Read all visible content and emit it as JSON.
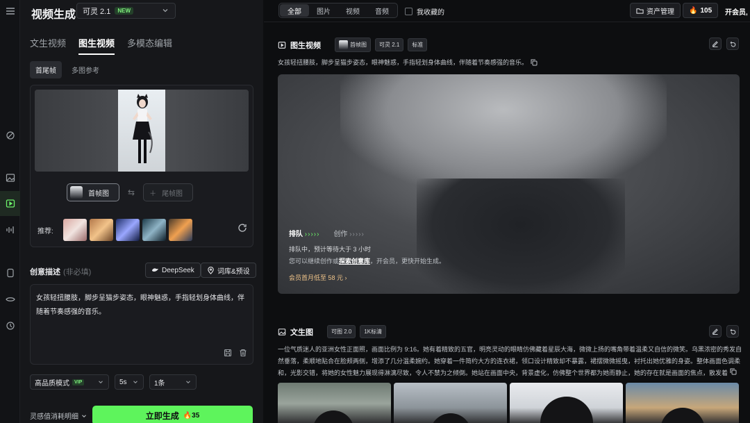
{
  "app": {
    "title": "视频生成"
  },
  "model": {
    "name": "可灵 2.1",
    "badge": "NEW"
  },
  "tabs": [
    {
      "label": "文生视频"
    },
    {
      "label": "图生视频"
    },
    {
      "label": "多模态编辑"
    }
  ],
  "subtabs": [
    {
      "label": "首尾帧"
    },
    {
      "label": "多图参考"
    }
  ],
  "frames": {
    "first": "首帧图",
    "last": "尾帧图"
  },
  "recommend_label": "推荐:",
  "description": {
    "label": "创意描述",
    "optional": "(非必填)",
    "deepseek": "DeepSeek",
    "library": "词库&预设",
    "text": "女孩轻扭腰肢，脚步呈猫步姿态，眼神魅惑，手指轻划身体曲线，伴随着节奏感强的音乐。"
  },
  "options": {
    "mode": "高品质模式",
    "mode_badge": "VIP",
    "duration": "5s",
    "count": "1条"
  },
  "consume_label": "灵感值消耗明细",
  "generate": {
    "label": "立即生成",
    "cost": "35"
  },
  "filter": [
    {
      "label": "全部"
    },
    {
      "label": "图片"
    },
    {
      "label": "视频"
    },
    {
      "label": "音频"
    }
  ],
  "favorites_label": "我收藏的",
  "asset_label": "资产管理",
  "points": "105",
  "vip_label": "开会员,",
  "result1": {
    "title": "图生视频",
    "tags": [
      "首帧图",
      "可灵 2.1",
      "标准"
    ],
    "prompt": "女孩轻扭腰肢，脚步呈猫步姿态，眼神魅惑，手指轻划身体曲线，伴随着节奏感强的音乐。",
    "queue_label": "排队",
    "create_label": "创作",
    "wait_text": "排队中，预计等待大于 3 小时",
    "tip_prefix": "您可以继续创作或",
    "tip_link": "探索创意库",
    "tip_suffix": "，开会员，更快开始生成。",
    "member_price": "会员首月低至 58 元"
  },
  "result2": {
    "title": "文生图",
    "tags": [
      "可图 2.0",
      "1K标清"
    ],
    "prompt": "一位气质迷人的亚洲女性正面照，画面比例为 9:16。她有着精致的五官，明亮灵动的眼睛仿佛藏着星辰大海，微微上扬的嘴角带着温柔又自信的微笑。乌黑浓密的秀发自然垂落，柔顺地贴合在脸颊两侧，增添了几分温柔婉约。她穿着一件简约大方的连衣裙，领口设计精致却不暴露，裙摆微微摇曳，衬托出她优雅的身姿。整体画面色调柔和，光影交错，将她的女性魅力展现得淋漓尽致，令人不禁为之倾倒。她站在画面中央，背景虚化，仿佛整个世界都为她而静止，她的存在就是画面的焦点，散发着"
  },
  "colors": {
    "accent": "#5ef45c",
    "vip_bg": "#24402a"
  }
}
